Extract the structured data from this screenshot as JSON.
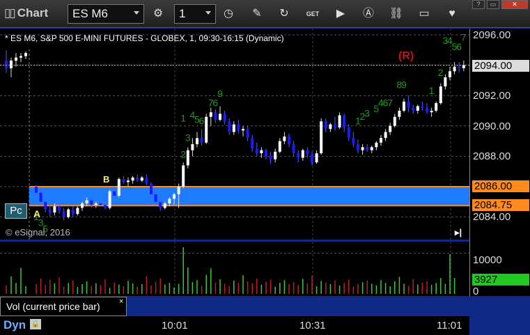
{
  "titlebar": {
    "title": "Chart",
    "symbol": "ES M6",
    "interval": "1",
    "icons": [
      "clock-settings-icon",
      "clock-icon",
      "pencil-icon",
      "refresh-icon",
      "get-icon",
      "play-icon",
      "alert-icon",
      "link-icon",
      "chat-icon",
      "twitter-icon"
    ],
    "window_buttons": [
      "?",
      "▭",
      "✕"
    ]
  },
  "chart": {
    "symbol_line": "* ES M6, S&P 500 E-MINI FUTURES - GLOBEX, 1, 09:30-16:15 (Dynamic)",
    "copyright": "© eSignal, 2016",
    "pc_button": "Pc",
    "scroll_end": "▸|",
    "r_marker": "(R)",
    "markers": {
      "a": "A",
      "b": "B"
    }
  },
  "price_axis": {
    "ticks": [
      "2096.00",
      "2094.00",
      "2092.00",
      "2090.00",
      "2088.00",
      "2084.00"
    ],
    "labels": {
      "last": "2094.00",
      "upper_band": "2086.00",
      "lower_band": "2084.75"
    }
  },
  "volume": {
    "label": "Vol (current price bar)",
    "close": "×",
    "ticks": [
      "10000",
      "0"
    ],
    "current": "3927"
  },
  "time_axis": {
    "ticks": [
      "10:01",
      "10:31",
      "11:01"
    ],
    "mode": "Dyn"
  },
  "colors": {
    "band": "#1e7cff",
    "band_edge": "#ff8a1e",
    "up": "#ffffff",
    "down": "#1a1aff",
    "td": "#1a9a1a",
    "vol_up": "#3acb3a",
    "vol_down": "#c02020",
    "current_vol": "#22c822"
  },
  "chart_data": {
    "type": "candlestick",
    "ylim": [
      2083.0,
      2097.0
    ],
    "value_area": [
      2084.75,
      2086.0
    ],
    "bars": [
      [
        2094.3,
        2095.0,
        2093.5,
        2093.8
      ],
      [
        2093.8,
        2094.5,
        2093.2,
        2094.3
      ],
      [
        2094.3,
        2094.8,
        2093.9,
        2094.5
      ],
      [
        2094.5,
        2094.8,
        2094.2,
        2094.6
      ],
      [
        2094.6,
        2094.9,
        2094.4,
        2094.8
      ],
      [
        2086.0,
        2086.1,
        2085.3,
        2085.6
      ],
      [
        2085.6,
        2085.8,
        2084.8,
        2085.0
      ],
      [
        2085.0,
        2085.2,
        2084.3,
        2084.5
      ],
      [
        2084.5,
        2084.8,
        2084.0,
        2084.3
      ],
      [
        2084.3,
        2084.9,
        2084.1,
        2084.7
      ],
      [
        2084.7,
        2085.0,
        2084.2,
        2084.4
      ],
      [
        2084.4,
        2084.6,
        2083.8,
        2084.0
      ],
      [
        2084.0,
        2084.6,
        2083.9,
        2084.5
      ],
      [
        2084.5,
        2084.7,
        2084.0,
        2084.2
      ],
      [
        2084.2,
        2084.7,
        2084.1,
        2084.6
      ],
      [
        2084.6,
        2085.0,
        2084.4,
        2084.9
      ],
      [
        2084.9,
        2085.3,
        2084.7,
        2085.1
      ],
      [
        2085.1,
        2085.3,
        2084.6,
        2084.8
      ],
      [
        2084.8,
        2085.0,
        2084.6,
        2084.9
      ],
      [
        2084.9,
        2085.1,
        2084.7,
        2084.8
      ],
      [
        2084.8,
        2085.0,
        2084.5,
        2084.6
      ],
      [
        2084.6,
        2085.8,
        2084.5,
        2085.7
      ],
      [
        2085.7,
        2086.0,
        2085.2,
        2085.4
      ],
      [
        2085.4,
        2086.6,
        2085.3,
        2086.5
      ],
      [
        2086.5,
        2086.7,
        2086.2,
        2086.3
      ],
      [
        2086.3,
        2086.6,
        2086.0,
        2086.4
      ],
      [
        2086.4,
        2086.7,
        2086.2,
        2086.6
      ],
      [
        2086.6,
        2086.8,
        2086.3,
        2086.4
      ],
      [
        2086.4,
        2086.7,
        2086.3,
        2086.6
      ],
      [
        2086.6,
        2086.8,
        2086.1,
        2086.2
      ],
      [
        2086.2,
        2086.3,
        2085.3,
        2085.5
      ],
      [
        2085.5,
        2085.7,
        2084.8,
        2085.0
      ],
      [
        2085.0,
        2085.2,
        2084.4,
        2084.6
      ],
      [
        2084.6,
        2085.0,
        2084.5,
        2084.9
      ],
      [
        2084.9,
        2085.3,
        2084.7,
        2085.2
      ],
      [
        2085.2,
        2085.6,
        2084.8,
        2085.5
      ],
      [
        2085.5,
        2086.2,
        2084.6,
        2086.0
      ],
      [
        2086.0,
        2087.6,
        2085.9,
        2087.4
      ],
      [
        2087.4,
        2088.6,
        2087.2,
        2088.4
      ],
      [
        2088.4,
        2089.2,
        2088.0,
        2088.8
      ],
      [
        2088.8,
        2089.6,
        2088.6,
        2089.2
      ],
      [
        2089.2,
        2089.8,
        2088.7,
        2088.9
      ],
      [
        2088.9,
        2090.8,
        2088.8,
        2090.6
      ],
      [
        2090.6,
        2091.2,
        2090.0,
        2090.9
      ],
      [
        2090.9,
        2091.1,
        2090.2,
        2090.4
      ],
      [
        2090.4,
        2091.3,
        2090.3,
        2090.8
      ],
      [
        2090.8,
        2091.0,
        2090.1,
        2090.3
      ],
      [
        2090.3,
        2090.5,
        2089.4,
        2089.6
      ],
      [
        2089.6,
        2090.3,
        2089.4,
        2090.1
      ],
      [
        2090.1,
        2090.4,
        2089.5,
        2089.7
      ],
      [
        2089.7,
        2090.0,
        2089.3,
        2089.8
      ],
      [
        2089.8,
        2090.0,
        2089.0,
        2089.2
      ],
      [
        2089.2,
        2089.4,
        2088.3,
        2088.5
      ],
      [
        2088.5,
        2088.9,
        2088.0,
        2088.2
      ],
      [
        2088.2,
        2088.6,
        2087.9,
        2088.4
      ],
      [
        2088.4,
        2088.5,
        2087.8,
        2088.0
      ],
      [
        2088.0,
        2088.3,
        2087.5,
        2087.8
      ],
      [
        2087.8,
        2088.5,
        2087.6,
        2088.3
      ],
      [
        2088.3,
        2089.2,
        2088.2,
        2089.0
      ],
      [
        2089.0,
        2089.6,
        2088.8,
        2089.3
      ],
      [
        2089.3,
        2089.5,
        2088.6,
        2088.8
      ],
      [
        2088.8,
        2089.0,
        2088.0,
        2088.2
      ],
      [
        2088.2,
        2088.4,
        2087.6,
        2087.9
      ],
      [
        2087.9,
        2088.5,
        2087.7,
        2088.4
      ],
      [
        2088.4,
        2088.6,
        2087.9,
        2088.1
      ],
      [
        2088.1,
        2088.3,
        2087.4,
        2087.6
      ],
      [
        2087.6,
        2088.4,
        2087.5,
        2088.2
      ],
      [
        2088.2,
        2090.5,
        2088.1,
        2090.3
      ],
      [
        2090.3,
        2090.5,
        2089.6,
        2089.8
      ],
      [
        2089.8,
        2090.2,
        2089.6,
        2090.1
      ],
      [
        2090.1,
        2090.6,
        2089.7,
        2089.9
      ],
      [
        2089.9,
        2090.9,
        2089.8,
        2090.7
      ],
      [
        2090.7,
        2090.8,
        2089.6,
        2089.9
      ],
      [
        2089.9,
        2090.1,
        2089.0,
        2089.2
      ],
      [
        2089.2,
        2089.6,
        2088.6,
        2088.8
      ],
      [
        2088.8,
        2089.1,
        2088.2,
        2088.4
      ],
      [
        2088.4,
        2088.8,
        2088.1,
        2088.6
      ],
      [
        2088.6,
        2088.8,
        2088.3,
        2088.4
      ],
      [
        2088.4,
        2088.7,
        2088.2,
        2088.6
      ],
      [
        2088.6,
        2089.0,
        2088.4,
        2088.9
      ],
      [
        2088.9,
        2089.4,
        2088.7,
        2089.2
      ],
      [
        2089.2,
        2089.8,
        2089.0,
        2089.6
      ],
      [
        2089.6,
        2090.2,
        2089.4,
        2090.0
      ],
      [
        2090.0,
        2090.8,
        2089.9,
        2090.6
      ],
      [
        2090.6,
        2091.2,
        2090.4,
        2091.0
      ],
      [
        2091.0,
        2091.8,
        2090.9,
        2091.6
      ],
      [
        2091.6,
        2092.0,
        2090.9,
        2091.2
      ],
      [
        2091.2,
        2091.4,
        2090.8,
        2091.0
      ],
      [
        2091.0,
        2091.4,
        2090.8,
        2091.3
      ],
      [
        2091.3,
        2091.6,
        2091.0,
        2091.2
      ],
      [
        2091.2,
        2091.5,
        2090.8,
        2090.9
      ],
      [
        2090.9,
        2091.2,
        2090.6,
        2091.0
      ],
      [
        2091.0,
        2091.6,
        2090.9,
        2091.5
      ],
      [
        2091.5,
        2092.8,
        2091.4,
        2092.6
      ],
      [
        2092.6,
        2093.4,
        2092.4,
        2093.2
      ],
      [
        2093.2,
        2093.9,
        2093.0,
        2093.6
      ],
      [
        2093.6,
        2094.2,
        2093.4,
        2093.9
      ],
      [
        2093.9,
        2094.2,
        2093.5,
        2093.8
      ],
      [
        2093.8,
        2094.3,
        2093.6,
        2094.0
      ]
    ],
    "volume_ylim": [
      0,
      12000
    ],
    "volumes": [
      2100,
      4300,
      2700,
      6400,
      1900,
      2400,
      3800,
      2200,
      3500,
      2600,
      4100,
      1800,
      2700,
      3300,
      1700,
      2400,
      3100,
      1900,
      2600,
      2200,
      3600,
      1500,
      2800,
      2300,
      1900,
      3200,
      2600,
      1800,
      2400,
      4400,
      2100,
      3000,
      3800,
      2300,
      2700,
      1600,
      2500,
      11500,
      6500,
      2900,
      3400,
      2000,
      4700,
      6300,
      2800,
      3600,
      2500,
      1900,
      3300,
      2700,
      4600,
      3100,
      2600,
      3800,
      2300,
      3000,
      3500,
      1800,
      2700,
      3400,
      2400,
      2900,
      2200,
      3700,
      2600,
      4500,
      1900,
      3200,
      2800,
      2400,
      3300,
      2100,
      2700,
      3500,
      1800,
      2400,
      2900,
      3300,
      2500,
      2100,
      3400,
      2700,
      1900,
      3100,
      4200,
      2500,
      2000,
      3600,
      2300,
      2800,
      3100,
      2200,
      2700,
      3900,
      2500,
      9800,
      3927
    ],
    "td_labels": [
      {
        "i": 43,
        "p": 2091.3,
        "t": "7"
      },
      {
        "i": 44,
        "p": 2091.3,
        "t": "6"
      },
      {
        "i": 45,
        "p": 2091.9,
        "t": "9"
      },
      {
        "i": 37,
        "p": 2090.3,
        "t": "1"
      },
      {
        "i": 39,
        "p": 2090.5,
        "t": "4"
      },
      {
        "i": 40,
        "p": 2090.2,
        "t": "5"
      },
      {
        "i": 41,
        "p": 2090.1,
        "t": "6"
      },
      {
        "i": 38,
        "p": 2089.0,
        "t": "3"
      },
      {
        "i": 37,
        "p": 2087.9,
        "t": "2"
      },
      {
        "i": 84,
        "p": 2092.5,
        "t": "8"
      },
      {
        "i": 85,
        "p": 2092.5,
        "t": "9"
      },
      {
        "i": 80,
        "p": 2091.3,
        "t": "4"
      },
      {
        "i": 81,
        "p": 2091.3,
        "t": "6"
      },
      {
        "i": 82,
        "p": 2091.3,
        "t": "7"
      },
      {
        "i": 79,
        "p": 2090.9,
        "t": "5"
      },
      {
        "i": 77,
        "p": 2090.6,
        "t": "3"
      },
      {
        "i": 76,
        "p": 2090.4,
        "t": "2"
      },
      {
        "i": 75,
        "p": 2090.1,
        "t": "1"
      },
      {
        "i": 91,
        "p": 2092.1,
        "t": "1"
      },
      {
        "i": 93,
        "p": 2093.3,
        "t": "2"
      },
      {
        "i": 94,
        "p": 2095.4,
        "t": "3"
      },
      {
        "i": 95,
        "p": 2095.4,
        "t": "4"
      },
      {
        "i": 96,
        "p": 2095.0,
        "t": "5"
      },
      {
        "i": 97,
        "p": 2095.0,
        "t": "6"
      },
      {
        "i": 98,
        "p": 2095.6,
        "t": "7"
      },
      {
        "i": 5,
        "p": 2083.8,
        "t": "1"
      },
      {
        "i": 6,
        "p": 2083.4,
        "t": "3"
      },
      {
        "i": 7,
        "p": 2083.0,
        "t": "5"
      }
    ]
  }
}
